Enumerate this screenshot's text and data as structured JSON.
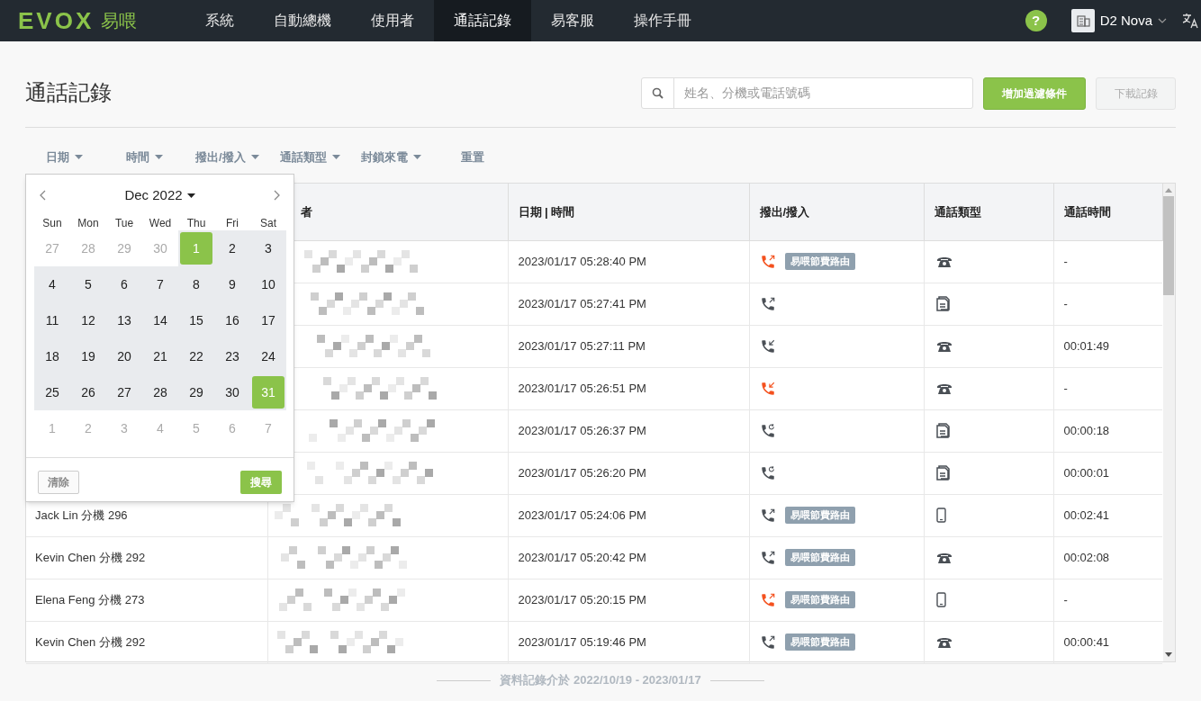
{
  "nav": {
    "logo": "EVOX",
    "logo_suffix": "易喂",
    "items": [
      {
        "label": "系統",
        "selected": false
      },
      {
        "label": "自動總機",
        "selected": false
      },
      {
        "label": "使用者",
        "selected": false
      },
      {
        "label": "通話記錄",
        "selected": true
      },
      {
        "label": "易客服",
        "selected": false
      },
      {
        "label": "操作手冊",
        "selected": false
      }
    ],
    "help": "?",
    "account": "D2 Nova"
  },
  "page": {
    "title": "通話記錄",
    "search": {
      "placeholder": "姓名、分機或電話號碼"
    },
    "add_filter": "增加過濾條件",
    "download": {
      "label": "下載記錄",
      "disabled": true
    }
  },
  "filters": [
    {
      "label": "日期",
      "dropdown": true
    },
    {
      "label": "時間",
      "dropdown": true
    },
    {
      "label": "撥出/撥入",
      "dropdown": true
    },
    {
      "label": "通話類型",
      "dropdown": true
    },
    {
      "label": "封鎖來電",
      "dropdown": true
    },
    {
      "label": "重置",
      "dropdown": false
    }
  ],
  "calendar": {
    "month": "Dec 2022",
    "weekdays": [
      "Sun",
      "Mon",
      "Tue",
      "Wed",
      "Thu",
      "Fri",
      "Sat"
    ],
    "weeks": [
      [
        {
          "day": "27",
          "muted": true,
          "in_range": false,
          "selected": false
        },
        {
          "day": "28",
          "muted": true,
          "in_range": false,
          "selected": false
        },
        {
          "day": "29",
          "muted": true,
          "in_range": false,
          "selected": false
        },
        {
          "day": "30",
          "muted": true,
          "in_range": false,
          "selected": false
        },
        {
          "day": "1",
          "muted": false,
          "in_range": true,
          "selected": true
        },
        {
          "day": "2",
          "muted": false,
          "in_range": true,
          "selected": false
        },
        {
          "day": "3",
          "muted": false,
          "in_range": true,
          "selected": false
        }
      ],
      [
        {
          "day": "4",
          "muted": false,
          "in_range": true,
          "selected": false
        },
        {
          "day": "5",
          "muted": false,
          "in_range": true,
          "selected": false
        },
        {
          "day": "6",
          "muted": false,
          "in_range": true,
          "selected": false
        },
        {
          "day": "7",
          "muted": false,
          "in_range": true,
          "selected": false
        },
        {
          "day": "8",
          "muted": false,
          "in_range": true,
          "selected": false
        },
        {
          "day": "9",
          "muted": false,
          "in_range": true,
          "selected": false
        },
        {
          "day": "10",
          "muted": false,
          "in_range": true,
          "selected": false
        }
      ],
      [
        {
          "day": "11",
          "muted": false,
          "in_range": true,
          "selected": false
        },
        {
          "day": "12",
          "muted": false,
          "in_range": true,
          "selected": false
        },
        {
          "day": "13",
          "muted": false,
          "in_range": true,
          "selected": false
        },
        {
          "day": "14",
          "muted": false,
          "in_range": true,
          "selected": false
        },
        {
          "day": "15",
          "muted": false,
          "in_range": true,
          "selected": false
        },
        {
          "day": "16",
          "muted": false,
          "in_range": true,
          "selected": false
        },
        {
          "day": "17",
          "muted": false,
          "in_range": true,
          "selected": false
        }
      ],
      [
        {
          "day": "18",
          "muted": false,
          "in_range": true,
          "selected": false
        },
        {
          "day": "19",
          "muted": false,
          "in_range": true,
          "selected": false
        },
        {
          "day": "20",
          "muted": false,
          "in_range": true,
          "selected": false
        },
        {
          "day": "21",
          "muted": false,
          "in_range": true,
          "selected": false
        },
        {
          "day": "22",
          "muted": false,
          "in_range": true,
          "selected": false
        },
        {
          "day": "23",
          "muted": false,
          "in_range": true,
          "selected": false
        },
        {
          "day": "24",
          "muted": false,
          "in_range": true,
          "selected": false
        }
      ],
      [
        {
          "day": "25",
          "muted": false,
          "in_range": true,
          "selected": false
        },
        {
          "day": "26",
          "muted": false,
          "in_range": true,
          "selected": false
        },
        {
          "day": "27",
          "muted": false,
          "in_range": true,
          "selected": false
        },
        {
          "day": "28",
          "muted": false,
          "in_range": true,
          "selected": false
        },
        {
          "day": "29",
          "muted": false,
          "in_range": true,
          "selected": false
        },
        {
          "day": "30",
          "muted": false,
          "in_range": true,
          "selected": false
        },
        {
          "day": "31",
          "muted": false,
          "in_range": true,
          "selected": true
        }
      ],
      [
        {
          "day": "1",
          "muted": true,
          "in_range": false,
          "selected": false
        },
        {
          "day": "2",
          "muted": true,
          "in_range": false,
          "selected": false
        },
        {
          "day": "3",
          "muted": true,
          "in_range": false,
          "selected": false
        },
        {
          "day": "4",
          "muted": true,
          "in_range": false,
          "selected": false
        },
        {
          "day": "5",
          "muted": true,
          "in_range": false,
          "selected": false
        },
        {
          "day": "6",
          "muted": true,
          "in_range": false,
          "selected": false
        },
        {
          "day": "7",
          "muted": true,
          "in_range": false,
          "selected": false
        }
      ]
    ],
    "clear": "清除",
    "search": "搜尋"
  },
  "table": {
    "columns": [
      "者",
      "日期 | 時間",
      "撥出/撥入",
      "通話類型",
      "通話時間"
    ],
    "rows": [
      {
        "datetime": "2023/01/17 05:28:40 PM",
        "direction": {
          "kind": "outgoing",
          "missed": true
        },
        "tag": "易喂節費路由",
        "call_type": {
          "kind": "landline"
        },
        "duration": "-"
      },
      {
        "datetime": "2023/01/17 05:27:41 PM",
        "direction": {
          "kind": "outgoing",
          "missed": false
        },
        "call_type": {
          "kind": "fax"
        },
        "duration": "-"
      },
      {
        "datetime": "2023/01/17 05:27:11 PM",
        "direction": {
          "kind": "incoming",
          "missed": false
        },
        "call_type": {
          "kind": "landline"
        },
        "duration": "00:01:49"
      },
      {
        "datetime": "2023/01/17 05:26:51 PM",
        "direction": {
          "kind": "incoming",
          "missed": true
        },
        "call_type": {
          "kind": "landline"
        },
        "duration": "-"
      },
      {
        "datetime": "2023/01/17 05:26:37 PM",
        "direction": {
          "kind": "transfer",
          "missed": false
        },
        "call_type": {
          "kind": "fax"
        },
        "duration": "00:00:18"
      },
      {
        "datetime": "2023/01/17 05:26:20 PM",
        "direction": {
          "kind": "transfer",
          "missed": false
        },
        "call_type": {
          "kind": "fax"
        },
        "duration": "00:00:01"
      },
      {
        "caller": "Jack Lin 分機 296",
        "datetime": "2023/01/17 05:24:06 PM",
        "direction": {
          "kind": "outgoing",
          "missed": false
        },
        "tag": "易喂節費路由",
        "call_type": {
          "kind": "mobile"
        },
        "duration": "00:02:41"
      },
      {
        "caller": "Kevin Chen 分機 292",
        "datetime": "2023/01/17 05:20:42 PM",
        "direction": {
          "kind": "outgoing",
          "missed": false
        },
        "tag": "易喂節費路由",
        "call_type": {
          "kind": "landline"
        },
        "duration": "00:02:08"
      },
      {
        "caller": "Elena Feng 分機 273",
        "datetime": "2023/01/17 05:20:15 PM",
        "direction": {
          "kind": "outgoing",
          "missed": true
        },
        "tag": "易喂節費路由",
        "call_type": {
          "kind": "mobile"
        },
        "duration": "-"
      },
      {
        "caller": "Kevin Chen 分機 292",
        "datetime": "2023/01/17 05:19:46 PM",
        "direction": {
          "kind": "outgoing",
          "missed": false
        },
        "tag": "易喂節費路由",
        "call_type": {
          "kind": "landline"
        },
        "duration": "00:00:41"
      }
    ]
  },
  "footer": "資料記錄介於 2022/10/19 - 2023/01/17"
}
